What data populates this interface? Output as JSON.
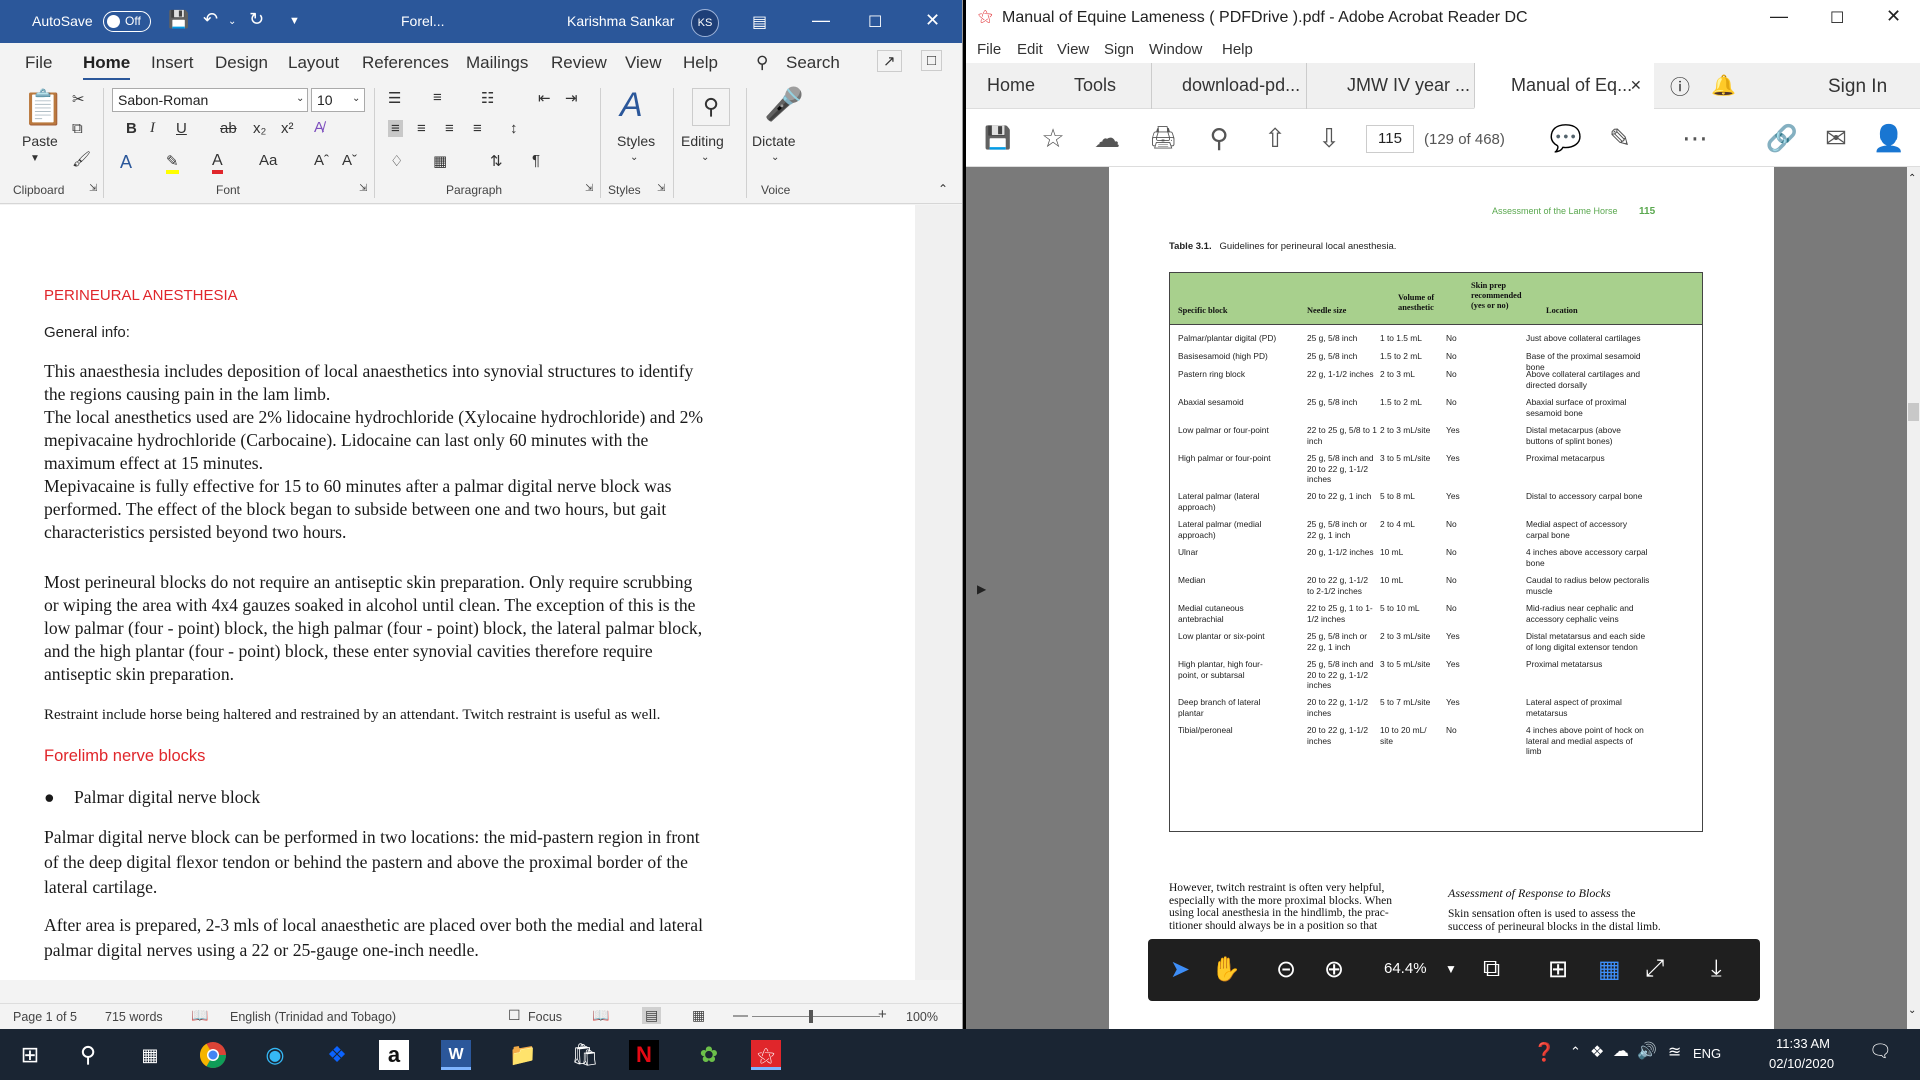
{
  "word": {
    "title": {
      "autosave_label": "AutoSave",
      "autosave_state": "Off",
      "doc_name": "Forel...",
      "user_name": "Karishma Sankar",
      "user_initials": "KS"
    },
    "tabs": [
      "File",
      "Home",
      "Insert",
      "Design",
      "Layout",
      "References",
      "Mailings",
      "Review",
      "View",
      "Help"
    ],
    "active_tab": "Home",
    "search_label": "Search",
    "ribbon": {
      "paste_label": "Paste",
      "clipboard_label": "Clipboard",
      "font_name": "Sabon-Roman",
      "font_size": "10",
      "font_label": "Font",
      "paragraph_label": "Paragraph",
      "styles_button": "Styles",
      "styles_label": "Styles",
      "editing_button": "Editing",
      "dictate_button": "Dictate",
      "voice_label": "Voice"
    },
    "document": {
      "heading1": "PERINEURAL ANESTHESIA",
      "general_info": "General info:",
      "para1_lines": [
        "This anaesthesia includes deposition of local anaesthetics into synovial structures to identify",
        "the regions causing pain in the lam limb.",
        "The local anesthetics used are 2% lidocaine hydrochloride (Xylocaine hydrochloride) and 2%",
        "mepivacaine hydrochloride (Carbocaine). Lidocaine can last only 60 minutes with the",
        "maximum effect at 15 minutes.",
        "Mepivacaine is fully effective for 15 to 60 minutes after a palmar digital nerve block was",
        "performed. The effect of the block began to subside between one and two hours, but gait",
        "characteristics persisted beyond two hours."
      ],
      "para2_lines": [
        "Most perineural blocks do not require an antiseptic skin preparation. Only require scrubbing",
        "or wiping the area with 4x4 gauzes soaked in alcohol until clean. The exception of this is the",
        "low palmar (four - point) block, the high palmar (four - point) block, the lateral palmar block,",
        "and the high plantar (four - point) block, these enter synovial cavities therefore require",
        "antiseptic skin preparation."
      ],
      "restraint": "Restraint include horse being haltered and restrained by an attendant. Twitch restraint is useful as well.",
      "heading2": "Forelimb nerve blocks",
      "bullet1": "Palmar digital nerve block",
      "para3_lines": [
        "Palmar digital nerve block can be performed in two locations: the mid-pastern region in front",
        "of the deep digital flexor tendon or behind the pastern and above the proximal border of the",
        "lateral cartilage."
      ],
      "para4_lines": [
        "After area is prepared, 2-3 mls of local anaesthetic are placed over both the medial and lateral",
        "palmar digital nerves using a 22 or 25-gauge one-inch needle."
      ]
    },
    "status": {
      "page": "Page 1 of 5",
      "words": "715 words",
      "language": "English (Trinidad and Tobago)",
      "focus": "Focus",
      "zoom": "100%"
    }
  },
  "acrobat": {
    "title": "Manual of Equine Lameness ( PDFDrive ).pdf - Adobe Acrobat Reader DC",
    "menu": [
      "File",
      "Edit",
      "View",
      "Sign",
      "Window",
      "Help"
    ],
    "tabs": {
      "home": "Home",
      "tools": "Tools",
      "docs": [
        "download-pd...",
        "JMW IV year ...",
        "Manual of Eq..."
      ],
      "sign_in": "Sign In"
    },
    "toolbar": {
      "page_number": "115",
      "page_of": "(129 of 468)"
    },
    "pdf": {
      "running_head": "Assessment of the Lame Horse",
      "page_num": "115",
      "table_label": "Table 3.1.",
      "table_caption": "Guidelines for perineural local anesthesia.",
      "headers": [
        "Specific block",
        "Needle size",
        "Volume of anesthetic",
        "Skin prep recommended (yes or no)",
        "Location"
      ],
      "rows": [
        [
          "Palmar/plantar digital (PD)",
          "25 g, 5/8 inch",
          "1 to 1.5 mL",
          "No",
          "Just above collateral cartilages"
        ],
        [
          "Basisesamoid (high PD)",
          "25 g, 5/8 inch",
          "1.5 to 2 mL",
          "No",
          "Base of the proximal sesamoid bone"
        ],
        [
          "Pastern ring block",
          "22 g, 1-1/2 inches",
          "2 to 3 mL",
          "No",
          "Above collateral cartilages and directed dorsally"
        ],
        [
          "Abaxial sesamoid",
          "25 g, 5/8 inch",
          "1.5 to 2 mL",
          "No",
          "Abaxial surface of proximal sesamoid bone"
        ],
        [
          "Low palmar or four-point",
          "22 to 25 g, 5/8 to 1 inch",
          "2 to 3 mL/site",
          "Yes",
          "Distal metacarpus (above buttons of splint bones)"
        ],
        [
          "High palmar or four-point",
          "25 g, 5/8 inch and 20 to 22 g, 1-1/2 inches",
          "3 to 5 mL/site",
          "Yes",
          "Proximal metacarpus"
        ],
        [
          "Lateral palmar (lateral approach)",
          "20 to 22 g, 1 inch",
          "5 to 8 mL",
          "Yes",
          "Distal to accessory carpal bone"
        ],
        [
          "Lateral palmar (medial approach)",
          "25 g, 5/8 inch or 22 g, 1 inch",
          "2 to 4 mL",
          "No",
          "Medial aspect of accessory carpal bone"
        ],
        [
          "Ulnar",
          "20 g, 1-1/2 inches",
          "10 mL",
          "No",
          "4 inches above accessory carpal bone"
        ],
        [
          "Median",
          "20 to 22 g, 1-1/2 to 2-1/2 inches",
          "10 mL",
          "No",
          "Caudal to radius below pectoralis muscle"
        ],
        [
          "Medial cutaneous antebrachial",
          "22 to 25 g, 1 to 1-1/2 inches",
          "5 to 10 mL",
          "No",
          "Mid-radius near cephalic and accessory cephalic veins"
        ],
        [
          "Low plantar or six-point",
          "25 g, 5/8 inch or 22 g, 1 inch",
          "2 to 3 mL/site",
          "Yes",
          "Distal metatarsus and each side of long digital extensor tendon"
        ],
        [
          "High plantar, high four-point, or subtarsal",
          "25 g, 5/8 inch and 20 to 22 g, 1-1/2 inches",
          "3 to 5 mL/site",
          "Yes",
          "Proximal metatarsus"
        ],
        [
          "Deep branch of lateral plantar",
          "20 to 22 g, 1-1/2 inches",
          "5 to 7 mL/site",
          "Yes",
          "Lateral aspect of proximal metatarsus"
        ],
        [
          "Tibial/peroneal",
          "20 to 22 g, 1-1/2 inches",
          "10 to 20 mL/ site",
          "No",
          "4 inches above point of hock on lateral and medial aspects of limb"
        ]
      ],
      "body_left": [
        "However, twitch restraint is often very helpful,",
        "especially with the more proximal blocks. When",
        "using local anesthesia in the hindlimb, the prac-",
        "titioner should always be in a position so that"
      ],
      "right_heading": "Assessment of Response to Blocks",
      "body_right": [
        "Skin sensation often is used to assess the",
        "success of perineural blocks in the distal limb."
      ]
    },
    "zoom": "64.4%"
  },
  "taskbar": {
    "language": "ENG",
    "time": "11:33 AM",
    "date": "02/10/2020"
  }
}
